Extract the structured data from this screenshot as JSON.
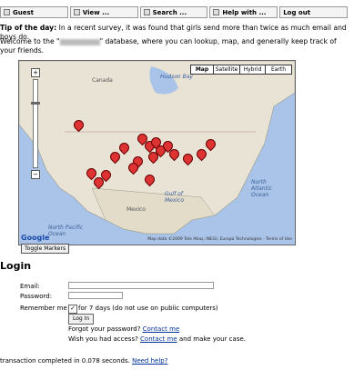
{
  "nav": [
    {
      "label": "Guest"
    },
    {
      "label": "View ..."
    },
    {
      "label": "Search ..."
    },
    {
      "label": "Help with ..."
    },
    {
      "label": "Log out"
    }
  ],
  "tip": {
    "title": "Tip of the day:",
    "text": "In a recent survey, it was found that girls send more than twice as much email and boys do."
  },
  "welcome": {
    "before": "Welcome to the \"",
    "after": "\" database, where you can lookup, map, and generally keep track of your friends."
  },
  "map": {
    "types": [
      "Map",
      "Satellite",
      "Hybrid",
      "Earth"
    ],
    "active_type": "Map",
    "zoom_in": "+",
    "zoom_out": "−",
    "labels": {
      "canada": "Canada",
      "hudson": "Hudson Bay",
      "mexico": "Mexico",
      "north_pacific": "North Pacific Ocean",
      "north_atlantic": "North Atlantic Ocean",
      "gulf": "Gulf of Mexico"
    },
    "google": "Google",
    "attribution": "Map data ©2009 Tele Atlas, INEGI, Europa Technologies - Terms of Use",
    "toggle_label": "Toggle Markers"
  },
  "login": {
    "heading": "Login",
    "email_label": "Email:",
    "password_label": "Password:",
    "remember_label": "Remember me",
    "remember_checked": true,
    "remember_note": "for 7 days (do not use on public computers)",
    "button": "Log In",
    "forgot_text": "Forgot your password?",
    "forgot_link": "Contact me",
    "access_text": "Wish you had access?",
    "access_link": "Contact me",
    "access_after": "and make your case."
  },
  "footer": {
    "text": "transaction completed in 0.078 seconds.",
    "help": "Need help?"
  }
}
